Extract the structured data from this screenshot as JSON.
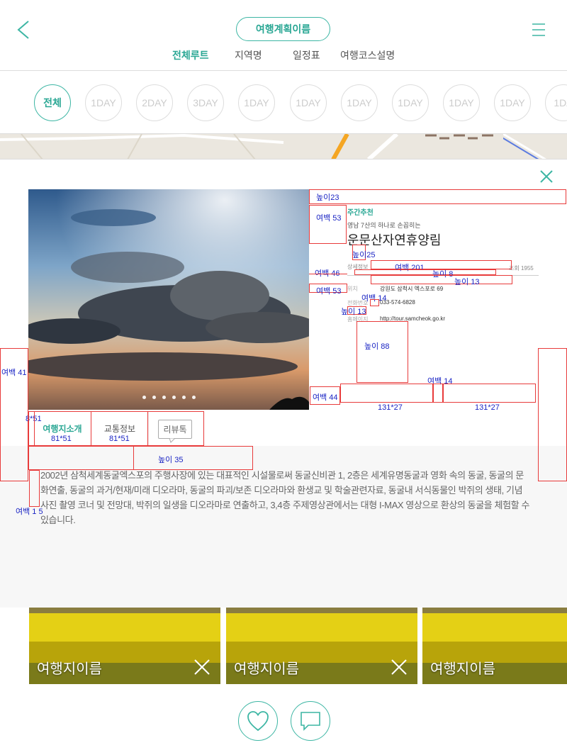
{
  "header": {
    "title": "여행계획이름",
    "tabs": [
      {
        "label": "전체루트",
        "active": true
      },
      {
        "label": "지역명",
        "active": false
      },
      {
        "label": "일정표",
        "active": false
      },
      {
        "label": "여행코스설명",
        "active": false
      }
    ]
  },
  "days": [
    "전체",
    "1DAY",
    "2DAY",
    "3DAY",
    "1DAY",
    "1DAY",
    "1DAY",
    "1DAY",
    "1DAY",
    "1DAY",
    "1DA"
  ],
  "detail": {
    "badge": "주간추천",
    "subtitle": "영남 7산의 하나로 손꼽히는",
    "name": "운문산자연휴양림",
    "detail_header": "상세정보",
    "views": "조회 1955",
    "rows": [
      {
        "label": "위치",
        "value": "강원도 삼척시 엑스포로 69"
      },
      {
        "label": "전화번호",
        "value": "033-574-6828"
      },
      {
        "label": "홈페이지",
        "value": "http://tour.samcheok.go.kr"
      }
    ],
    "info_tabs": [
      "여행지소개",
      "교통정보"
    ],
    "review_label": "리뷰톡",
    "description": "2002년 삼척세계동굴엑스포의 주행사장에 있는 대표적인 시설물로써 동굴신비관 1, 2층은 세계유명동굴과 영화 속의 동굴, 동굴의 문화연출, 동굴의 과거/현재/미래 디오라마, 동굴의 파괴/보존 디오라마와 환생교 및 학술관련자료, 동굴내 서식동물인 박쥐의 생태, 기념사진 촬영 코너 및 전망대, 박쥐의 일생을 디오라마로 연출하고, 3,4층 주제영상관에서는 대형 I-MAX 영상으로 환상의 동굴을 체험할 수 있습니다.",
    "photo_dots": 6
  },
  "annotations": {
    "h23": "높이23",
    "m53a": "여백 53",
    "h25": "높이25",
    "m46": "여백 46",
    "m201": "여백 201",
    "h8": "높이 8",
    "h13a": "높이 13",
    "m53b": "여백 53",
    "m14a": "여백 14",
    "h13b": "높이 13",
    "h88": "높이 88",
    "m14b": "여백 14",
    "m44": "여백 44",
    "s131a": "131*27",
    "s131b": "131*27",
    "m41": "여백 41",
    "s8x51": "8*51",
    "s81a": "81*51",
    "s81b": "81*51",
    "h35": "높이 35",
    "m15": "여백 1 5"
  },
  "cards": [
    {
      "title": "여행지이름",
      "closable": true
    },
    {
      "title": "여행지이름",
      "closable": true
    },
    {
      "title": "여행지이름",
      "closable": false
    }
  ],
  "colors": {
    "accent": "#3db6a4",
    "annotation_red": "#e83b3b",
    "annotation_blue": "#1b25c4"
  }
}
